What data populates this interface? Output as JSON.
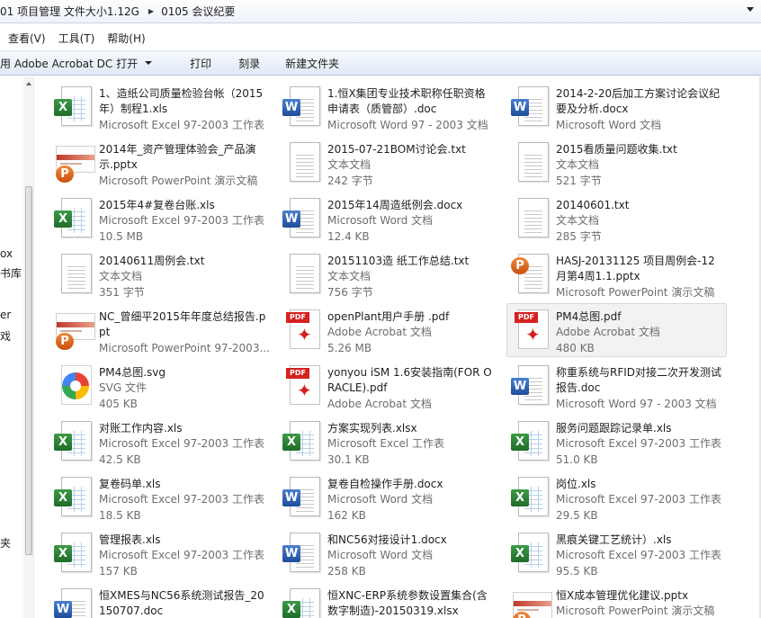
{
  "address": {
    "crumbs": [
      "01 项目管理 文件大小1.12G",
      "0105 会议纪要"
    ]
  },
  "menu": {
    "items": [
      "查看(V)",
      "工具(T)",
      "帮助(H)"
    ]
  },
  "commands": {
    "open_with": "使用 Adobe Acrobat DC 打开",
    "print": "打印",
    "burn": "刻录",
    "new_folder": "新建文件夹"
  },
  "nav": {
    "items": [
      "ox",
      "书库",
      "er",
      "戏",
      "夹"
    ]
  },
  "files": [
    {
      "name": "1、造纸公司质量检验台帐（2015年）制程1.xls",
      "type": "Microsoft Excel 97-2003 工作表",
      "size": "",
      "icon": "excel-icon"
    },
    {
      "name": "1.恒X集团专业技术职称任职资格申请表（质管部）.doc",
      "type": "Microsoft Word 97 - 2003 文档",
      "size": "",
      "icon": "word-icon"
    },
    {
      "name": "2014-2-20后加工方案讨论会议纪要及分析.docx",
      "type": "Microsoft Word 文档",
      "size": "",
      "icon": "word-icon"
    },
    {
      "name": "2014年_资产管理体验会_产品演示.pptx",
      "type": "Microsoft PowerPoint 演示文稿",
      "size": "",
      "icon": "powerpoint-thumb-icon"
    },
    {
      "name": "2015-07-21BOM讨论会.txt",
      "type": "文本文档",
      "size": "242 字节",
      "icon": "text-icon"
    },
    {
      "name": "2015看质量问题收集.txt",
      "type": "文本文档",
      "size": "521 字节",
      "icon": "text-icon"
    },
    {
      "name": "2015年4#复卷台账.xls",
      "type": "Microsoft Excel 97-2003 工作表",
      "size": "10.5 MB",
      "icon": "excel-icon"
    },
    {
      "name": "2015年14周造纸例会.docx",
      "type": "Microsoft Word 文档",
      "size": "12.4 KB",
      "icon": "word-icon"
    },
    {
      "name": "20140601.txt",
      "type": "文本文档",
      "size": "285 字节",
      "icon": "text-icon"
    },
    {
      "name": "20140611周例会.txt",
      "type": "文本文档",
      "size": "351 字节",
      "icon": "text-icon"
    },
    {
      "name": "20151103造 纸工作总结.txt",
      "type": "文本文档",
      "size": "756 字节",
      "icon": "text-icon"
    },
    {
      "name": "HASJ-20131125 项目周例会-12月第4周1.1.pptx",
      "type": "Microsoft PowerPoint 演示文稿",
      "size": "",
      "icon": "powerpoint-icon"
    },
    {
      "name": "NC_曾细平2015年年度总结报告.ppt",
      "type": "Microsoft PowerPoint 97-2003...",
      "size": "",
      "icon": "powerpoint-thumb-icon"
    },
    {
      "name": "openPlant用户手册 .pdf",
      "type": "Adobe Acrobat 文档",
      "size": "5.26 MB",
      "icon": "pdf-icon"
    },
    {
      "name": "PM4总图.pdf",
      "type": "Adobe Acrobat 文档",
      "size": "480 KB",
      "icon": "pdf-icon",
      "selected": true
    },
    {
      "name": "PM4总图.svg",
      "type": "SVG 文件",
      "size": "405 KB",
      "icon": "svg-icon"
    },
    {
      "name": "yonyou iSM 1.6安装指南(FOR ORACLE).pdf",
      "type": "Adobe Acrobat 文档",
      "size": "",
      "icon": "pdf-icon"
    },
    {
      "name": "称重系统与RFID对接二次开发测试报告.doc",
      "type": "Microsoft Word 97 - 2003 文档",
      "size": "",
      "icon": "word-icon"
    },
    {
      "name": "对账工作内容.xls",
      "type": "Microsoft Excel 97-2003 工作表",
      "size": "42.5 KB",
      "icon": "excel-icon"
    },
    {
      "name": "方案实现列表.xlsx",
      "type": "Microsoft Excel 工作表",
      "size": "30.1 KB",
      "icon": "excel-icon"
    },
    {
      "name": "服务问题跟踪记录单.xls",
      "type": "Microsoft Excel 97-2003 工作表",
      "size": "51.0 KB",
      "icon": "excel-icon"
    },
    {
      "name": "复卷码单.xls",
      "type": "Microsoft Excel 97-2003 工作表",
      "size": "18.5 KB",
      "icon": "excel-icon"
    },
    {
      "name": "复卷自检操作手册.docx",
      "type": "Microsoft Word 文档",
      "size": "162 KB",
      "icon": "word-icon"
    },
    {
      "name": "岗位.xls",
      "type": "Microsoft Excel 97-2003 工作表",
      "size": "29.5 KB",
      "icon": "excel-icon"
    },
    {
      "name": "管理报表.xls",
      "type": "Microsoft Excel 97-2003 工作表",
      "size": "157 KB",
      "icon": "excel-icon"
    },
    {
      "name": "和NC56对接设计1.docx",
      "type": "Microsoft Word 文档",
      "size": "258 KB",
      "icon": "word-icon"
    },
    {
      "name": "黑痕关键工艺统计）.xls",
      "type": "Microsoft Excel 97-2003 工作表",
      "size": "95.5 KB",
      "icon": "excel-icon"
    },
    {
      "name": "恒XMES与NC56系统测试报告_20150707.doc",
      "type": "",
      "size": "",
      "icon": "word-icon"
    },
    {
      "name": "恒XNC-ERP系统参数设置集合(含数字制造)-20150319.xlsx",
      "type": "",
      "size": "",
      "icon": "excel-icon"
    },
    {
      "name": "恒X成本管理优化建议.pptx",
      "type": "Microsoft PowerPoint 演示文稿",
      "size": "",
      "icon": "powerpoint-thumb-icon"
    }
  ]
}
